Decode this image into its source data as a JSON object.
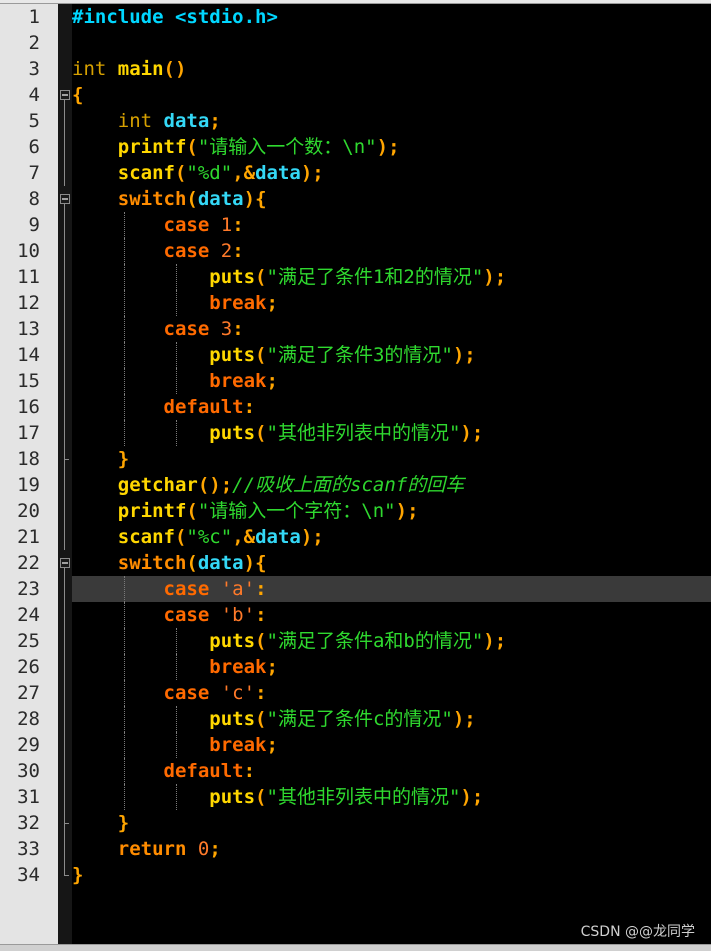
{
  "editor": {
    "current_line": 23,
    "lines": [
      {
        "n": "1",
        "tokens": [
          [
            "preproc",
            "#include <stdio.h>"
          ]
        ]
      },
      {
        "n": "2",
        "tokens": []
      },
      {
        "n": "3",
        "tokens": [
          [
            "type",
            "int"
          ],
          [
            "plain",
            " "
          ],
          [
            "func",
            "main"
          ],
          [
            "punct",
            "()"
          ]
        ]
      },
      {
        "n": "4",
        "tokens": [
          [
            "punct",
            "{"
          ]
        ]
      },
      {
        "n": "5",
        "tokens": [
          [
            "plain",
            "    "
          ],
          [
            "type",
            "int"
          ],
          [
            "plain",
            " "
          ],
          [
            "ident",
            "data"
          ],
          [
            "punct",
            ";"
          ]
        ]
      },
      {
        "n": "6",
        "tokens": [
          [
            "plain",
            "    "
          ],
          [
            "func",
            "printf"
          ],
          [
            "punct",
            "("
          ],
          [
            "str",
            "\"请输入一个数：\\n\""
          ],
          [
            "punct",
            ");"
          ]
        ]
      },
      {
        "n": "7",
        "tokens": [
          [
            "plain",
            "    "
          ],
          [
            "func",
            "scanf"
          ],
          [
            "punct",
            "("
          ],
          [
            "str",
            "\"%d\""
          ],
          [
            "punct",
            ",&"
          ],
          [
            "ident",
            "data"
          ],
          [
            "punct",
            ");"
          ]
        ]
      },
      {
        "n": "8",
        "tokens": [
          [
            "plain",
            "    "
          ],
          [
            "kw",
            "switch"
          ],
          [
            "punct",
            "("
          ],
          [
            "ident",
            "data"
          ],
          [
            "punct",
            "){"
          ]
        ]
      },
      {
        "n": "9",
        "tokens": [
          [
            "plain",
            "        "
          ],
          [
            "kw2",
            "case"
          ],
          [
            "plain",
            " "
          ],
          [
            "num",
            "1"
          ],
          [
            "punct",
            ":"
          ]
        ]
      },
      {
        "n": "10",
        "tokens": [
          [
            "plain",
            "        "
          ],
          [
            "kw2",
            "case"
          ],
          [
            "plain",
            " "
          ],
          [
            "num",
            "2"
          ],
          [
            "punct",
            ":"
          ]
        ]
      },
      {
        "n": "11",
        "tokens": [
          [
            "plain",
            "            "
          ],
          [
            "func",
            "puts"
          ],
          [
            "punct",
            "("
          ],
          [
            "str",
            "\"满足了条件1和2的情况\""
          ],
          [
            "punct",
            ");"
          ]
        ]
      },
      {
        "n": "12",
        "tokens": [
          [
            "plain",
            "            "
          ],
          [
            "kw2",
            "break"
          ],
          [
            "punct",
            ";"
          ]
        ]
      },
      {
        "n": "13",
        "tokens": [
          [
            "plain",
            "        "
          ],
          [
            "kw2",
            "case"
          ],
          [
            "plain",
            " "
          ],
          [
            "num",
            "3"
          ],
          [
            "punct",
            ":"
          ]
        ]
      },
      {
        "n": "14",
        "tokens": [
          [
            "plain",
            "            "
          ],
          [
            "func",
            "puts"
          ],
          [
            "punct",
            "("
          ],
          [
            "str",
            "\"满足了条件3的情况\""
          ],
          [
            "punct",
            ");"
          ]
        ]
      },
      {
        "n": "15",
        "tokens": [
          [
            "plain",
            "            "
          ],
          [
            "kw2",
            "break"
          ],
          [
            "punct",
            ";"
          ]
        ]
      },
      {
        "n": "16",
        "tokens": [
          [
            "plain",
            "        "
          ],
          [
            "kw2",
            "default"
          ],
          [
            "punct",
            ":"
          ]
        ]
      },
      {
        "n": "17",
        "tokens": [
          [
            "plain",
            "            "
          ],
          [
            "func",
            "puts"
          ],
          [
            "punct",
            "("
          ],
          [
            "str",
            "\"其他非列表中的情况\""
          ],
          [
            "punct",
            ");"
          ]
        ]
      },
      {
        "n": "18",
        "tokens": [
          [
            "plain",
            "    "
          ],
          [
            "punct",
            "}"
          ]
        ]
      },
      {
        "n": "19",
        "tokens": [
          [
            "plain",
            "    "
          ],
          [
            "func",
            "getchar"
          ],
          [
            "punct",
            "();"
          ],
          [
            "cmt",
            "//吸收上面的scanf的回车"
          ]
        ]
      },
      {
        "n": "20",
        "tokens": [
          [
            "plain",
            "    "
          ],
          [
            "func",
            "printf"
          ],
          [
            "punct",
            "("
          ],
          [
            "str",
            "\"请输入一个字符：\\n\""
          ],
          [
            "punct",
            ");"
          ]
        ]
      },
      {
        "n": "21",
        "tokens": [
          [
            "plain",
            "    "
          ],
          [
            "func",
            "scanf"
          ],
          [
            "punct",
            "("
          ],
          [
            "str",
            "\"%c\""
          ],
          [
            "punct",
            ",&"
          ],
          [
            "ident",
            "data"
          ],
          [
            "punct",
            ");"
          ]
        ]
      },
      {
        "n": "22",
        "tokens": [
          [
            "plain",
            "    "
          ],
          [
            "kw",
            "switch"
          ],
          [
            "punct",
            "("
          ],
          [
            "ident",
            "data"
          ],
          [
            "punct",
            "){"
          ]
        ]
      },
      {
        "n": "23",
        "tokens": [
          [
            "plain",
            "        "
          ],
          [
            "kw2",
            "case"
          ],
          [
            "plain",
            " "
          ],
          [
            "num",
            "'a'"
          ],
          [
            "punct",
            ":"
          ]
        ]
      },
      {
        "n": "24",
        "tokens": [
          [
            "plain",
            "        "
          ],
          [
            "kw2",
            "case"
          ],
          [
            "plain",
            " "
          ],
          [
            "num",
            "'b'"
          ],
          [
            "punct",
            ":"
          ]
        ]
      },
      {
        "n": "25",
        "tokens": [
          [
            "plain",
            "            "
          ],
          [
            "func",
            "puts"
          ],
          [
            "punct",
            "("
          ],
          [
            "str",
            "\"满足了条件a和b的情况\""
          ],
          [
            "punct",
            ");"
          ]
        ]
      },
      {
        "n": "26",
        "tokens": [
          [
            "plain",
            "            "
          ],
          [
            "kw2",
            "break"
          ],
          [
            "punct",
            ";"
          ]
        ]
      },
      {
        "n": "27",
        "tokens": [
          [
            "plain",
            "        "
          ],
          [
            "kw2",
            "case"
          ],
          [
            "plain",
            " "
          ],
          [
            "num",
            "'c'"
          ],
          [
            "punct",
            ":"
          ]
        ]
      },
      {
        "n": "28",
        "tokens": [
          [
            "plain",
            "            "
          ],
          [
            "func",
            "puts"
          ],
          [
            "punct",
            "("
          ],
          [
            "str",
            "\"满足了条件c的情况\""
          ],
          [
            "punct",
            ");"
          ]
        ]
      },
      {
        "n": "29",
        "tokens": [
          [
            "plain",
            "            "
          ],
          [
            "kw2",
            "break"
          ],
          [
            "punct",
            ";"
          ]
        ]
      },
      {
        "n": "30",
        "tokens": [
          [
            "plain",
            "        "
          ],
          [
            "kw2",
            "default"
          ],
          [
            "punct",
            ":"
          ]
        ]
      },
      {
        "n": "31",
        "tokens": [
          [
            "plain",
            "            "
          ],
          [
            "func",
            "puts"
          ],
          [
            "punct",
            "("
          ],
          [
            "str",
            "\"其他非列表中的情况\""
          ],
          [
            "punct",
            ");"
          ]
        ]
      },
      {
        "n": "32",
        "tokens": [
          [
            "plain",
            "    "
          ],
          [
            "punct",
            "}"
          ]
        ]
      },
      {
        "n": "33",
        "tokens": [
          [
            "plain",
            "    "
          ],
          [
            "kw",
            "return"
          ],
          [
            "plain",
            " "
          ],
          [
            "num",
            "0"
          ],
          [
            "punct",
            ";"
          ]
        ]
      },
      {
        "n": "34",
        "tokens": [
          [
            "punct",
            "}"
          ]
        ]
      }
    ]
  },
  "watermark": "CSDN @@龙同学",
  "colors": {
    "background": "#000000",
    "gutter": "#e4e4e4",
    "current_line": "#3a3a3a",
    "keyword": "#ff8c00",
    "identifier": "#34d8f6",
    "function": "#ffd700",
    "string": "#2fd92f",
    "number": "#ff7a2a"
  },
  "icons": {
    "fold_open": "fold-minus-icon"
  }
}
